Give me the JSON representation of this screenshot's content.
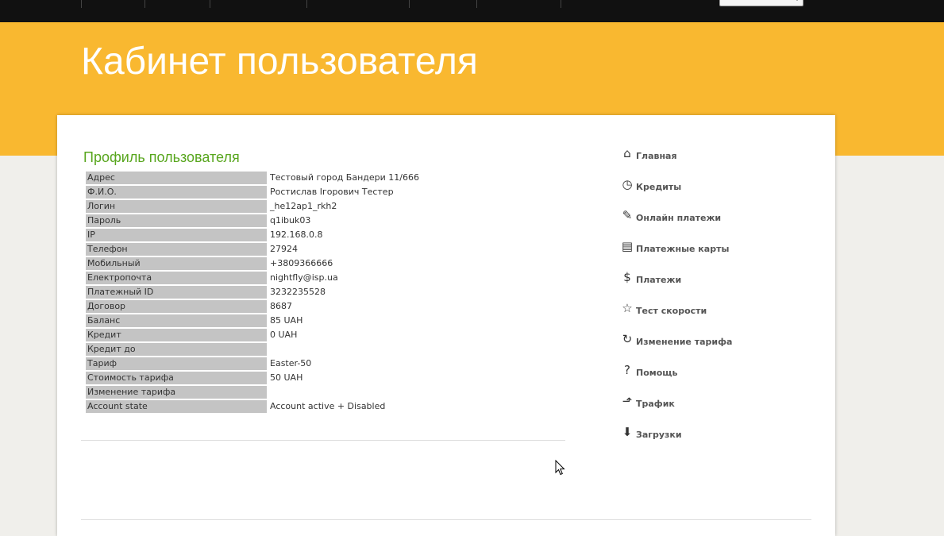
{
  "header": {
    "title": "Кабинет пользователя"
  },
  "profile": {
    "title": "Профиль пользователя",
    "rows": [
      {
        "label": "Адрес",
        "value": "Тестовый город Бандери 11/666"
      },
      {
        "label": "Ф.И.О.",
        "value": "Ростислав Ігорович Тестер"
      },
      {
        "label": "Логин",
        "value": "_he12ap1_rkh2"
      },
      {
        "label": "Пароль",
        "value": "q1ibuk03"
      },
      {
        "label": "IP",
        "value": "192.168.0.8"
      },
      {
        "label": "Телефон",
        "value": "27924"
      },
      {
        "label": "Мобильный",
        "value": "+3809366666"
      },
      {
        "label": "Електропочта",
        "value": "nightfly@isp.ua"
      },
      {
        "label": "Платежный ID",
        "value": "3232235528"
      },
      {
        "label": "Договор",
        "value": "8687"
      },
      {
        "label": "Баланс",
        "value": "85 UAH"
      },
      {
        "label": "Кредит",
        "value": "0 UAH"
      },
      {
        "label": "Кредит до",
        "value": ""
      },
      {
        "label": "Тариф",
        "value": "Easter-50"
      },
      {
        "label": "Стоимость тарифа",
        "value": "50 UAH"
      },
      {
        "label": "Изменение тарифа",
        "value": ""
      },
      {
        "label": "Account state",
        "value": "Account active + Disabled"
      }
    ]
  },
  "menu": {
    "items": [
      {
        "label": "Главная",
        "icon": "home-icon",
        "glyph": "⌂"
      },
      {
        "label": "Кредиты",
        "icon": "clock-icon",
        "glyph": "◷"
      },
      {
        "label": "Онлайн платежи",
        "icon": "money-icon",
        "glyph": "✎"
      },
      {
        "label": "Платежные карты",
        "icon": "receipt-icon",
        "glyph": "▤"
      },
      {
        "label": "Платежи",
        "icon": "dollar-icon",
        "glyph": "$"
      },
      {
        "label": "Тест скорости",
        "icon": "star-icon",
        "glyph": "☆"
      },
      {
        "label": "Изменение тарифа",
        "icon": "refresh-icon",
        "glyph": "↻"
      },
      {
        "label": "Помощь",
        "icon": "question-icon",
        "glyph": "?"
      },
      {
        "label": "Трафик",
        "icon": "chart-icon",
        "glyph": "⬏"
      },
      {
        "label": "Загрузки",
        "icon": "download-icon",
        "glyph": "⬇"
      }
    ]
  }
}
